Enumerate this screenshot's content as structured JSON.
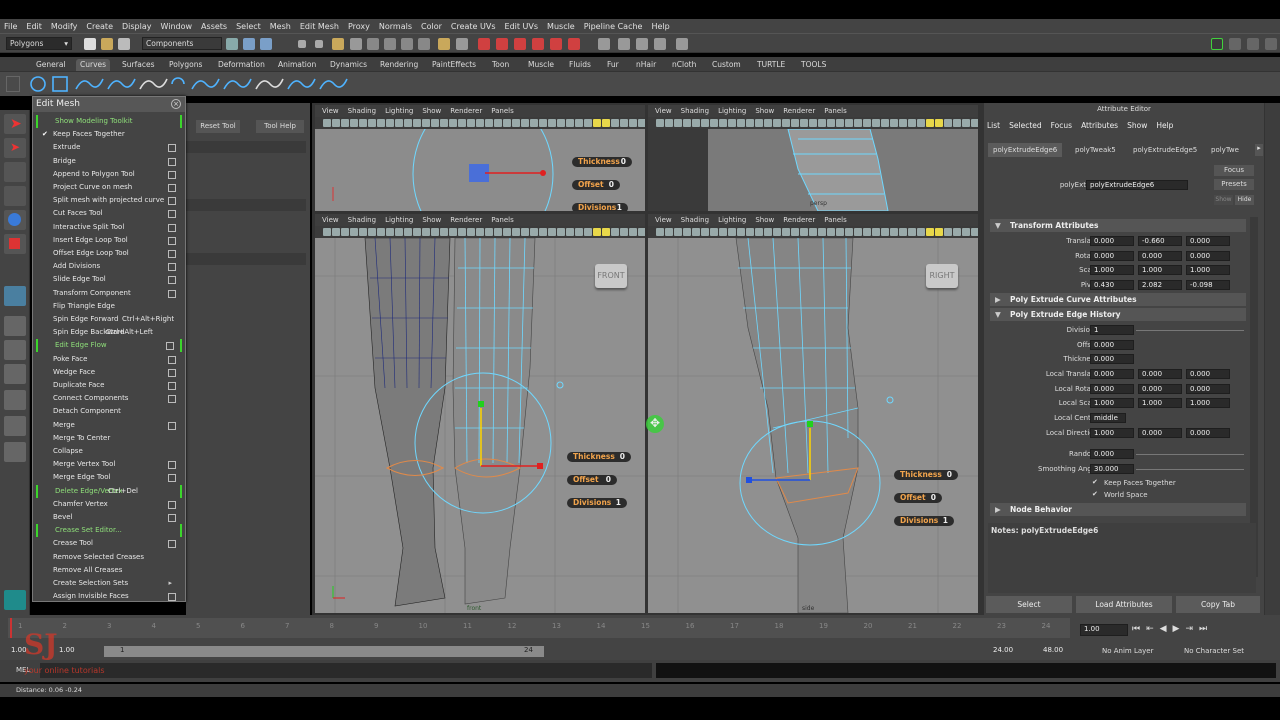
{
  "menubar": [
    "File",
    "Edit",
    "Modify",
    "Create",
    "Display",
    "Window",
    "Assets",
    "Select",
    "Mesh",
    "Edit Mesh",
    "Proxy",
    "Normals",
    "Color",
    "Create UVs",
    "Edit UVs",
    "Muscle",
    "Pipeline Cache",
    "Help"
  ],
  "status": {
    "menuset": "Polygons",
    "selection_mode": "Components"
  },
  "shelf_tabs": [
    "General",
    "Curves",
    "Surfaces",
    "Polygons",
    "Deformation",
    "Animation",
    "Dynamics",
    "Rendering",
    "PaintEffects",
    "Toon",
    "Muscle",
    "Fluids",
    "Fur",
    "nHair",
    "nCloth",
    "Custom",
    "TURTLE",
    "TOOLS"
  ],
  "shelf_active": "Curves",
  "editmesh": {
    "title": "Edit Mesh",
    "items": [
      {
        "label": "Show Modeling Toolkit",
        "green": true,
        "bar": true,
        "box": false
      },
      {
        "label": "Keep Faces Together",
        "check": true,
        "box": false
      },
      {
        "label": "Extrude",
        "box": true
      },
      {
        "label": "Bridge",
        "box": true
      },
      {
        "label": "Append to Polygon Tool",
        "box": true
      },
      {
        "label": "Project Curve on mesh",
        "box": true
      },
      {
        "label": "Split mesh with projected curve",
        "box": true
      },
      {
        "label": "Cut Faces Tool",
        "box": true
      },
      {
        "label": "Interactive Split Tool",
        "box": true
      },
      {
        "label": "Insert Edge Loop Tool",
        "box": true
      },
      {
        "label": "Offset Edge Loop Tool",
        "box": true
      },
      {
        "label": "Add Divisions",
        "box": true
      },
      {
        "label": "Slide Edge Tool",
        "box": true
      },
      {
        "label": "Transform Component",
        "box": true
      },
      {
        "label": "Flip Triangle Edge",
        "box": false
      },
      {
        "label": "Spin Edge Forward",
        "accel": "Ctrl+Alt+Right",
        "box": false
      },
      {
        "label": "Spin Edge Backward",
        "accel": "Ctrl+Alt+Left",
        "box": false
      },
      {
        "label": "Edit Edge Flow",
        "green": true,
        "bar": true,
        "box": true
      },
      {
        "label": "Poke Face",
        "box": true
      },
      {
        "label": "Wedge Face",
        "box": true
      },
      {
        "label": "Duplicate Face",
        "box": true
      },
      {
        "label": "Connect Components",
        "box": true
      },
      {
        "label": "Detach Component",
        "box": false
      },
      {
        "label": "Merge",
        "box": true
      },
      {
        "label": "Merge To Center",
        "box": false
      },
      {
        "label": "Collapse",
        "box": false
      },
      {
        "label": "Merge Vertex Tool",
        "box": true
      },
      {
        "label": "Merge Edge Tool",
        "box": true
      },
      {
        "label": "Delete Edge/Vertex",
        "accel": "Ctrl+Del",
        "green": true,
        "bar": true,
        "box": false
      },
      {
        "label": "Chamfer Vertex",
        "box": true
      },
      {
        "label": "Bevel",
        "box": true
      },
      {
        "label": "Crease Set Editor...",
        "green": true,
        "bar": true,
        "box": false
      },
      {
        "label": "Crease Tool",
        "box": true
      },
      {
        "label": "Remove Selected Creases",
        "box": false
      },
      {
        "label": "Remove All Creases",
        "box": false
      },
      {
        "label": "Create Selection Sets",
        "arrow": true,
        "box": false
      },
      {
        "label": "Assign Invisible Faces",
        "box": true
      }
    ]
  },
  "toolsettings": {
    "reset": "Reset Tool",
    "help": "Tool Help"
  },
  "viewport_menu": [
    "View",
    "Shading",
    "Lighting",
    "Show",
    "Renderer",
    "Panels"
  ],
  "hud": {
    "thickness_label": "Thickness",
    "thickness": "0",
    "offset_label": "Offset",
    "offset": "0",
    "divisions_label": "Divisions",
    "divisions": "1"
  },
  "views": {
    "front": "FRONT",
    "right": "RIGHT",
    "front_cam": "front",
    "side_cam": "side",
    "persp_cam": "persp"
  },
  "attr": {
    "title": "Attribute Editor",
    "menu": [
      "List",
      "Selected",
      "Focus",
      "Attributes",
      "Show",
      "Help"
    ],
    "tabs": [
      "polyExtrudeEdge6",
      "polyTweak5",
      "polyExtrudeEdge5",
      "polyTwe"
    ],
    "node_label": "polyExtrudeEdge:",
    "node_value": "polyExtrudeEdge6",
    "focus": "Focus",
    "presets": "Presets",
    "show": "Show",
    "hide": "Hide",
    "transform_section": "Transform Attributes",
    "translate": [
      "0.000",
      "-0.660",
      "0.000"
    ],
    "rotate": [
      "0.000",
      "0.000",
      "0.000"
    ],
    "scale": [
      "1.000",
      "1.000",
      "1.000"
    ],
    "pivot": [
      "0.430",
      "2.082",
      "-0.098"
    ],
    "curve_section": "Poly Extrude Curve Attributes",
    "history_section": "Poly Extrude Edge History",
    "divisions": "1",
    "offset": "0.000",
    "thickness": "0.000",
    "local_translate": [
      "0.000",
      "0.000",
      "0.000"
    ],
    "local_rotate": [
      "0.000",
      "0.000",
      "0.000"
    ],
    "local_scale": [
      "1.000",
      "1.000",
      "1.000"
    ],
    "local_center": "middle",
    "local_direction": [
      "1.000",
      "0.000",
      "0.000"
    ],
    "random": "0.000",
    "smoothing_angle": "30.000",
    "keep_faces": "Keep Faces Together",
    "world_space": "World Space",
    "node_behavior": "Node Behavior",
    "notes": "Notes: polyExtrudeEdge6",
    "labels": {
      "translate": "Translate",
      "rotate": "Rotate",
      "scale": "Scale",
      "pivot": "Pivot",
      "divisions": "Divisions",
      "offset": "Offset",
      "thickness": "Thickness",
      "local_translate": "Local Translate",
      "local_rotate": "Local Rotate",
      "local_scale": "Local Scale",
      "local_center": "Local Center",
      "local_direction": "Local Direction",
      "random": "Random",
      "smoothing_angle": "Smoothing Angle"
    },
    "buttons": {
      "select": "Select",
      "load": "Load Attributes",
      "copy": "Copy Tab"
    }
  },
  "timeline": {
    "ticks": [
      "1",
      "2",
      "3",
      "4",
      "5",
      "6",
      "7",
      "8",
      "9",
      "10",
      "11",
      "12",
      "13",
      "14",
      "15",
      "16",
      "17",
      "18",
      "19",
      "20",
      "21",
      "22",
      "23",
      "24"
    ],
    "current": "1.00",
    "range_start": "1.00",
    "range_inner_start": "1.00",
    "range_inner_frame": "1",
    "range_inner_end": "24",
    "range_end": "24.00",
    "range_end2": "48.00",
    "anim_layer": "No Anim Layer",
    "char_set": "No Character Set"
  },
  "cmd": {
    "label": "MEL"
  },
  "help": {
    "text": "Distance: 0.06  -0.24"
  },
  "watermark": {
    "logo": "SJ",
    "tagline": "your online tutorials"
  }
}
